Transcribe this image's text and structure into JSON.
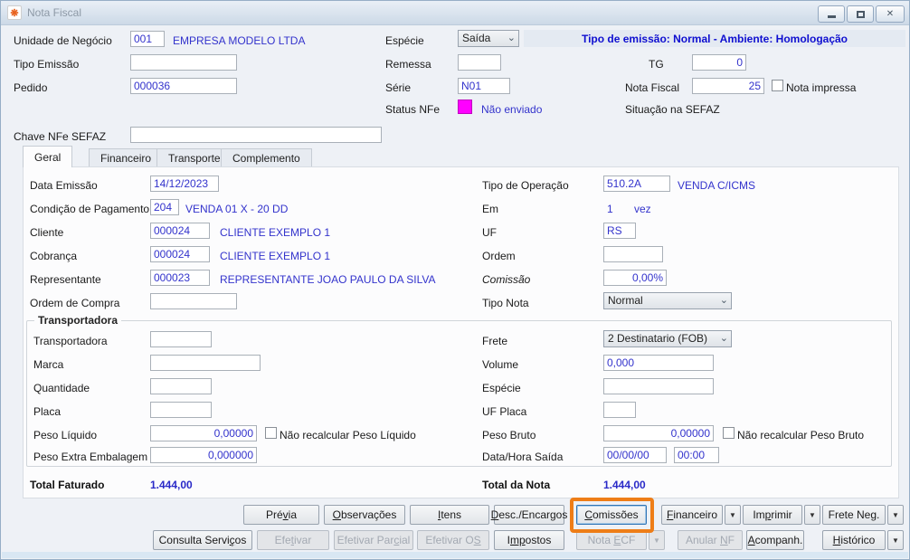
{
  "window": {
    "title": "Nota Fiscal"
  },
  "icons": {
    "app": "❋",
    "close": "✕",
    "dropdown": "▼",
    "combo": "⌄"
  },
  "colors": {
    "accent_blue": "#3333cc",
    "banner_blue": "#0f0fd0",
    "status_magenta": "#ff00ff",
    "highlight_orange": "#ee7d17"
  },
  "banner": {
    "text": "Tipo de emissão: Normal - Ambiente: Homologação"
  },
  "header": {
    "unidade_label": "Unidade de Negócio",
    "unidade_code": "001",
    "unidade_desc": "EMPRESA MODELO LTDA",
    "especie_label": "Espécie",
    "especie_value": "Saída",
    "tipo_emissao_label": "Tipo Emissão",
    "tipo_emissao_value": "",
    "remessa_label": "Remessa",
    "remessa_value": "",
    "tg_label": "TG",
    "tg_value": "0",
    "pedido_label": "Pedido",
    "pedido_value": "000036",
    "serie_label": "Série",
    "serie_value": "N01",
    "nota_fiscal_label": "Nota Fiscal",
    "nota_fiscal_value": "25",
    "nota_impressa_label": "Nota impressa",
    "status_nfe_label": "Status NFe",
    "status_nfe_value": "Não enviado",
    "situacao_label": "Situação na SEFAZ",
    "chave_label": "Chave NFe SEFAZ",
    "chave_value": ""
  },
  "tabs": [
    {
      "label": "Geral"
    },
    {
      "label": "Financeiro"
    },
    {
      "label": "Transporte"
    },
    {
      "label": "Complemento"
    }
  ],
  "geral": {
    "data_emissao": {
      "label": "Data Emissão",
      "value": "14/12/2023"
    },
    "condicao": {
      "label": "Condição de Pagamento",
      "code": "204",
      "desc": "VENDA 01 X - 20 DD"
    },
    "cliente": {
      "label": "Cliente",
      "code": "000024",
      "desc": "CLIENTE EXEMPLO 1"
    },
    "cobranca": {
      "label": "Cobrança",
      "code": "000024",
      "desc": "CLIENTE EXEMPLO 1"
    },
    "representante": {
      "label": "Representante",
      "code": "000023",
      "desc": "REPRESENTANTE JOAO PAULO DA SILVA"
    },
    "ordem_compra": {
      "label": "Ordem de Compra",
      "value": ""
    },
    "tipo_operacao": {
      "label": "Tipo de Operação",
      "code": "510.2A",
      "desc": "VENDA C/ICMS"
    },
    "em": {
      "label": "Em",
      "value": "1",
      "suffix": "vez"
    },
    "uf": {
      "label": "UF",
      "value": "RS"
    },
    "ordem": {
      "label": "Ordem",
      "value": ""
    },
    "comissao": {
      "label": "Comissão",
      "value": "0,00%"
    },
    "tipo_nota": {
      "label": "Tipo Nota",
      "value": "Normal"
    }
  },
  "transporte": {
    "group_title": "Transportadora",
    "transportadora": {
      "label": "Transportadora",
      "value": ""
    },
    "marca": {
      "label": "Marca",
      "value": ""
    },
    "quantidade": {
      "label": "Quantidade",
      "value": ""
    },
    "placa": {
      "label": "Placa",
      "value": ""
    },
    "peso_liquido": {
      "label": "Peso Líquido",
      "value": "0,00000",
      "checkbox": "Não recalcular Peso Líquido"
    },
    "peso_extra": {
      "label": "Peso Extra Embalagem",
      "value": "0,000000"
    },
    "frete": {
      "label": "Frete",
      "value": "2 Destinatario (FOB)"
    },
    "volume": {
      "label": "Volume",
      "value": "0,000"
    },
    "especie": {
      "label": "Espécie",
      "value": ""
    },
    "uf_placa": {
      "label": "UF Placa",
      "value": ""
    },
    "peso_bruto": {
      "label": "Peso Bruto",
      "value": "0,00000",
      "checkbox": "Não recalcular Peso Bruto"
    },
    "data_hora_saida": {
      "label": "Data/Hora Saída",
      "date": "00/00/00",
      "time": "00:00"
    }
  },
  "totais": {
    "faturado_label": "Total Faturado",
    "faturado_value": "1.444,00",
    "nota_label": "Total da Nota",
    "nota_value": "1.444,00"
  },
  "buttons": {
    "previa": {
      "pre": "Pré",
      "key": "v",
      "post": "ia"
    },
    "observacoes": {
      "pre": "",
      "key": "O",
      "post": "bservações"
    },
    "itens": {
      "pre": "",
      "key": "I",
      "post": "tens"
    },
    "desc_encargos": {
      "pre": "",
      "key": "D",
      "post": "esc./Encargos"
    },
    "comissoes": {
      "pre": "",
      "key": "C",
      "post": "omissões"
    },
    "financeiro": {
      "pre": "",
      "key": "F",
      "post": "inanceiro"
    },
    "imprimir": {
      "pre": "Im",
      "key": "p",
      "post": "rimir"
    },
    "frete_neg": {
      "pre": "Frete Ne",
      "key": "g",
      "post": "."
    },
    "consulta_servicos": {
      "pre": "Consulta Servi",
      "key": "ç",
      "post": "os"
    },
    "efetivar": {
      "pre": "Efe",
      "key": "t",
      "post": "ivar"
    },
    "efetivar_parcial": {
      "pre": "Efetivar Par",
      "key": "c",
      "post": "ial"
    },
    "efetivar_os": {
      "pre": "Efetivar O",
      "key": "S",
      "post": ""
    },
    "impostos": {
      "pre": "I",
      "key": "mp",
      "post": "ostos"
    },
    "nota_ecf": {
      "pre": "Nota ",
      "key": "E",
      "post": "CF"
    },
    "anular_nf": {
      "pre": "Anular ",
      "key": "N",
      "post": "F"
    },
    "acompanh": {
      "pre": "",
      "key": "A",
      "post": "companh."
    },
    "historico": {
      "pre": "",
      "key": "H",
      "post": "istórico"
    }
  }
}
